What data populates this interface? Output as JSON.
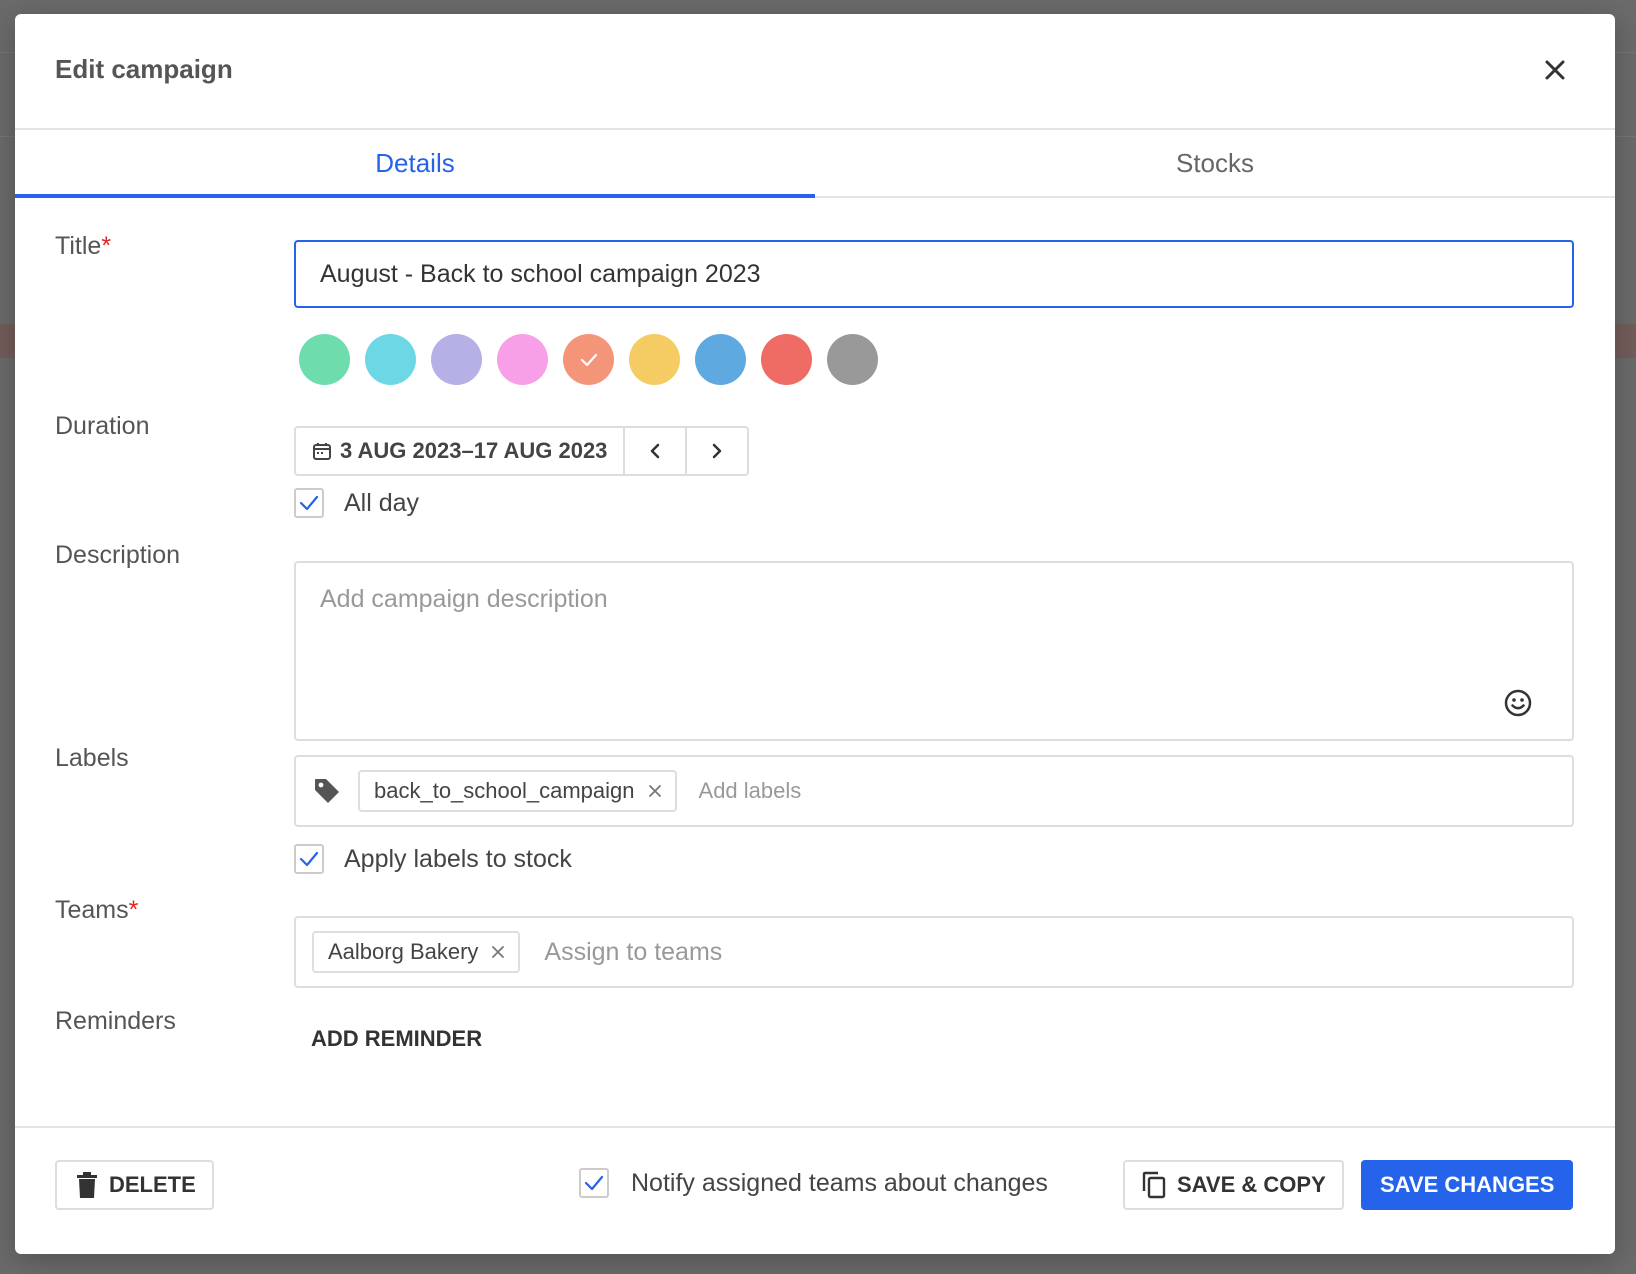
{
  "modal": {
    "title": "Edit campaign",
    "close_icon": "close-icon"
  },
  "tabs": [
    {
      "label": "Details",
      "active": true
    },
    {
      "label": "Stocks",
      "active": false
    }
  ],
  "form": {
    "title_label": "Title",
    "title_required": "*",
    "title_value": "August - Back to school campaign 2023",
    "colors": [
      "#6fdcae",
      "#6dd7e6",
      "#b5b0e6",
      "#f7a0e8",
      "#f4957a",
      "#f5cb63",
      "#5ea9e0",
      "#ef6c64",
      "#999999"
    ],
    "selected_color_index": 4,
    "duration_label": "Duration",
    "duration_value": "3 AUG 2023–17 AUG 2023",
    "all_day_label": "All day",
    "all_day_checked": true,
    "description_label": "Description",
    "description_placeholder": "Add campaign description",
    "labels_label": "Labels",
    "label_chips": [
      "back_to_school_campaign"
    ],
    "labels_placeholder": "Add labels",
    "apply_labels_label": "Apply labels to stock",
    "apply_labels_checked": true,
    "teams_label": "Teams",
    "teams_required": "*",
    "team_chips": [
      "Aalborg Bakery"
    ],
    "teams_placeholder": "Assign to teams",
    "reminders_label": "Reminders",
    "add_reminder_label": "ADD REMINDER"
  },
  "footer": {
    "delete_label": "DELETE",
    "notify_label": "Notify assigned teams about changes",
    "notify_checked": true,
    "save_copy_label": "SAVE & COPY",
    "save_changes_label": "SAVE CHANGES"
  },
  "accent_color": "#2563eb"
}
